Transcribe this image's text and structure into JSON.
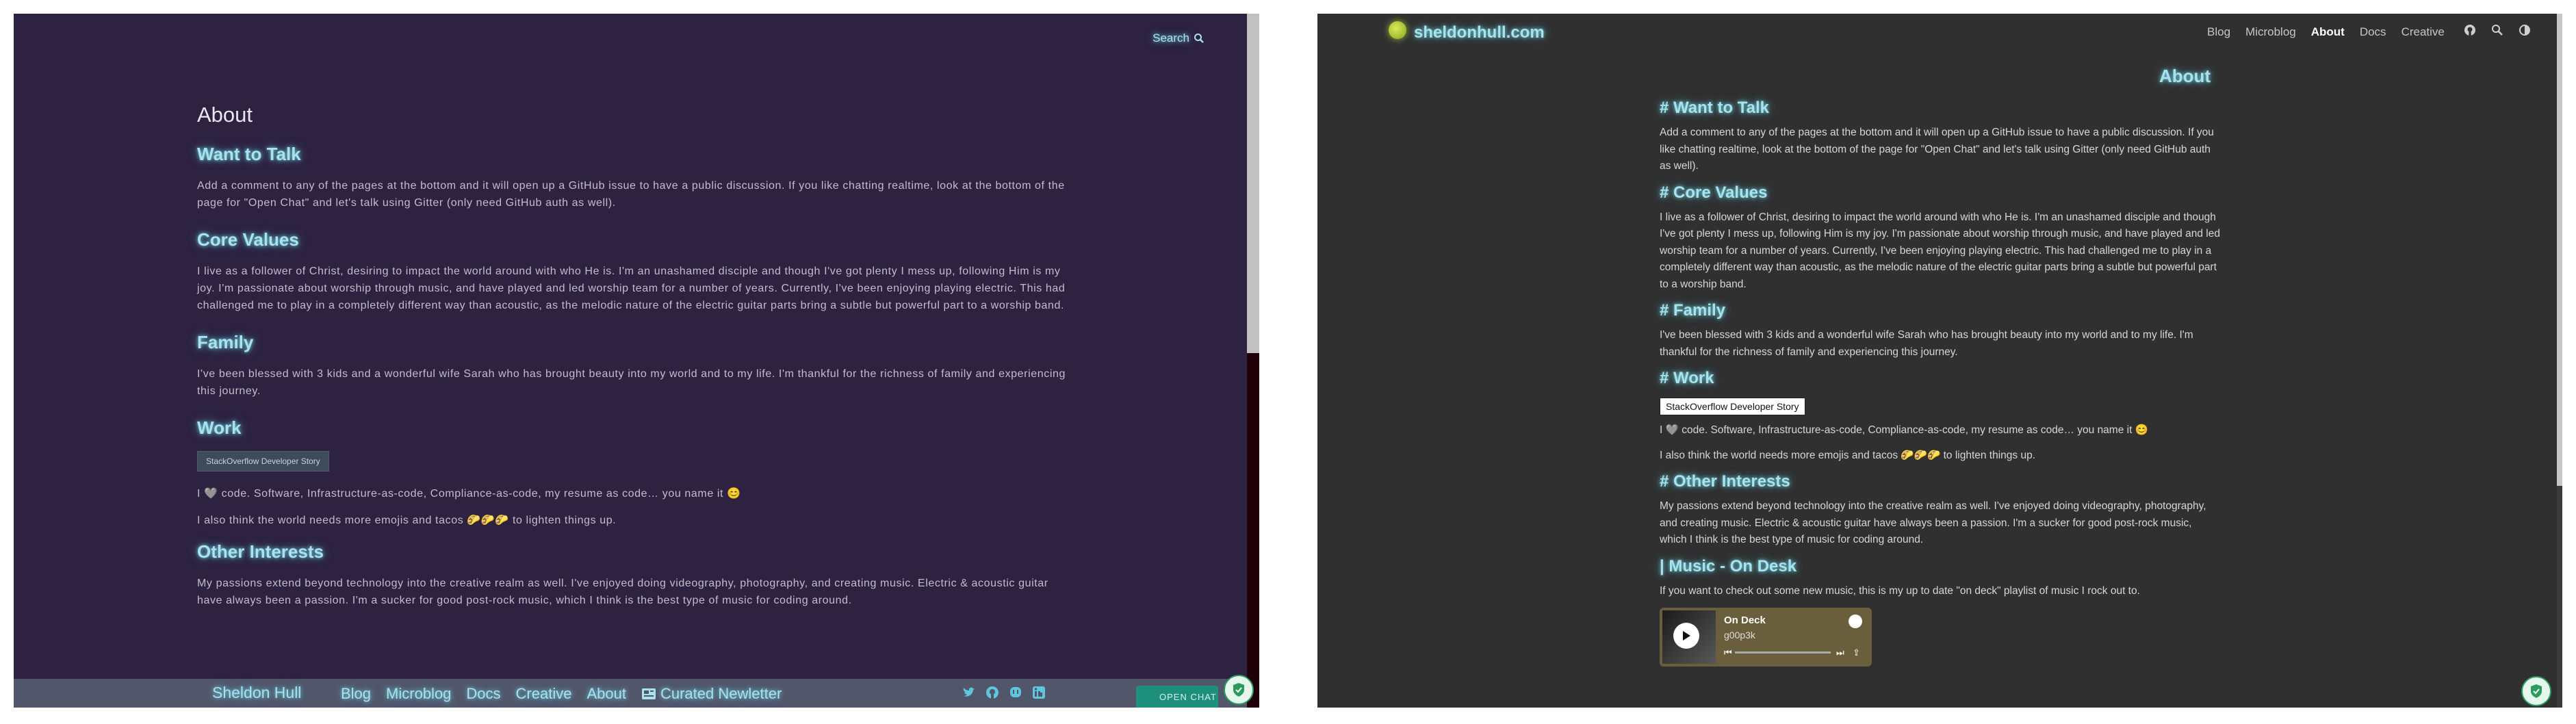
{
  "left": {
    "search_label": "Search",
    "page_title": "About",
    "sections": {
      "talk": {
        "heading": "Want to Talk",
        "text": "Add a comment to any of the pages at the bottom and it will open up a GitHub issue to have a public discussion. If you like chatting realtime, look at the bottom of the page for \"Open Chat\" and let's talk using Gitter (only need GitHub auth as well)."
      },
      "values": {
        "heading": "Core Values",
        "text": "I live as a follower of Christ, desiring to impact the world around with who He is. I'm an unashamed disciple and though I've got plenty I mess up, following Him is my joy. I'm passionate about worship through music, and have played and led worship team for a number of years. Currently, I've been enjoying playing electric. This had challenged me to play in a completely different way than acoustic, as the melodic nature of the electric guitar parts bring a subtle but powerful part to a worship band."
      },
      "family": {
        "heading": "Family",
        "text": "I've been blessed with 3 kids and a wonderful wife Sarah who has brought beauty into my world and to my life. I'm thankful for the richness of family and experiencing this journey."
      },
      "work": {
        "heading": "Work",
        "badge": "StackOverflow Developer Story",
        "line1": "I 🩶 code. Software, Infrastructure-as-code, Compliance-as-code, my resume as code… you name it 😊",
        "line2": "I also think the world needs more emojis and tacos 🌮🌮🌮 to lighten things up."
      },
      "other": {
        "heading": "Other Interests",
        "text": "My passions extend beyond technology into the creative realm as well. I've enjoyed doing videography, photography, and creating music. Electric & acoustic guitar have always been a passion. I'm a sucker for good post-rock music, which I think is the best type of music for coding around."
      }
    },
    "footer": {
      "brand": "Sheldon Hull",
      "nav": [
        "Blog",
        "Microblog",
        "Docs",
        "Creative",
        "About"
      ],
      "newsletter": "Curated Newletter",
      "social_icons": [
        "twitter-icon",
        "github-icon",
        "mastodon-icon",
        "linkedin-icon"
      ],
      "open_chat": "OPEN CHAT"
    }
  },
  "right": {
    "site_name": "sheldonhull.com",
    "nav": [
      "Blog",
      "Microblog",
      "About",
      "Docs",
      "Creative"
    ],
    "nav_active": "About",
    "nav_icons": [
      "github-icon",
      "search-icon",
      "theme-toggle-icon"
    ],
    "page_title": "About",
    "sections": {
      "talk": {
        "heading": "# Want to Talk",
        "text": "Add a comment to any of the pages at the bottom and it will open up a GitHub issue to have a public discussion. If you like chatting realtime, look at the bottom of the page for \"Open Chat\" and let's talk using Gitter (only need GitHub auth as well)."
      },
      "values": {
        "heading": "# Core Values",
        "text": "I live as a follower of Christ, desiring to impact the world around with who He is. I'm an unashamed disciple and though I've got plenty I mess up, following Him is my joy. I'm passionate about worship through music, and have played and led worship team for a number of years. Currently, I've been enjoying playing electric. This had challenged me to play in a completely different way than acoustic, as the melodic nature of the electric guitar parts bring a subtle but powerful part to a worship band."
      },
      "family": {
        "heading": "# Family",
        "text": "I've been blessed with 3 kids and a wonderful wife Sarah who has brought beauty into my world and to my life. I'm thankful for the richness of family and experiencing this journey."
      },
      "work": {
        "heading": "# Work",
        "badge": "StackOverflow Developer Story",
        "line1": "I 🩶 code. Software, Infrastructure-as-code, Compliance-as-code, my resume as code… you name it 😊",
        "line2": "I also think the world needs more emojis and tacos 🌮🌮🌮 to lighten things up."
      },
      "other": {
        "heading": "# Other Interests",
        "text": "My passions extend beyond technology into the creative realm as well. I've enjoyed doing videography, photography, and creating music. Electric & acoustic guitar have always been a passion. I'm a sucker for good post-rock music, which I think is the best type of music for coding around."
      },
      "music": {
        "heading": "| Music - On Desk",
        "text": "If you want to check out some new music, this is my up to date \"on deck\" playlist of music I rock out to."
      }
    },
    "spotify": {
      "title": "On Deck",
      "artist": "g00p3k"
    }
  },
  "colors": {
    "left_bg": "#2d2240",
    "right_bg": "#303030",
    "glow": "#a8e2ec",
    "chat_green": "#1d8f7a"
  }
}
